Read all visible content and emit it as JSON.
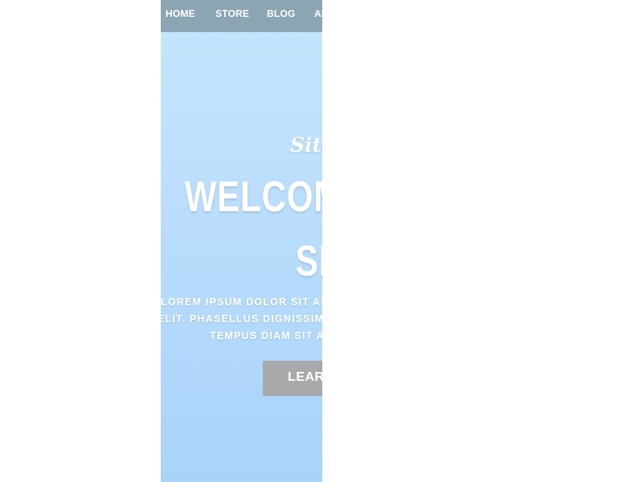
{
  "nav": {
    "items": [
      {
        "label": "HOME"
      },
      {
        "label": "STORE"
      },
      {
        "label": "BLOG"
      },
      {
        "label": "AB"
      }
    ]
  },
  "hero": {
    "tagline": "Site",
    "title_line1": "WELCOM",
    "title_line2": "SI",
    "body_line1": "LOREM IPSUM DOLOR SIT AM",
    "body_line2": "ELIT. PHASELLUS DIGNISSIM",
    "body_line3": "TEMPUS DIAM SIT A",
    "button_label": "LEAR"
  },
  "colors": {
    "nav_bar": "#8ba5b3",
    "hero_top": "#c7e6fd",
    "hero_bottom": "#a9d3f9",
    "button": "#a7a9aa",
    "text": "#ffffff"
  }
}
